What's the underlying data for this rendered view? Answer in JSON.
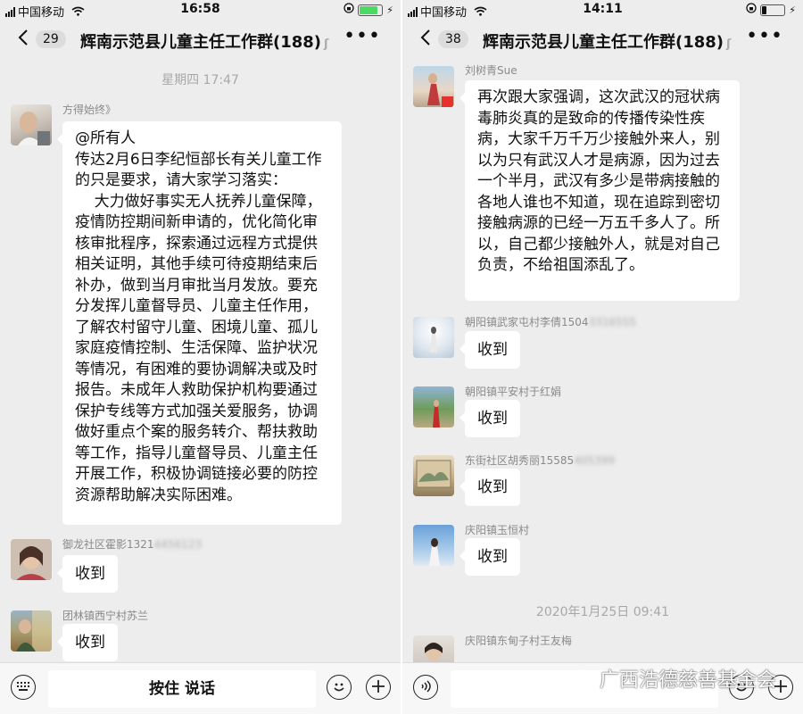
{
  "left": {
    "status": {
      "carrier": "中国移动",
      "time": "16:58"
    },
    "nav": {
      "back_count": "29",
      "title": "辉南示范县儿童主任工作群(188)"
    },
    "timestamp": "星期四 17:47",
    "messages": [
      {
        "sender": "方得始终》",
        "text": "@所有人\n传达2月6日李纪恒部长有关儿童工作的只是要求，请大家学习落实：\n    大力做好事实无人抚养儿童保障，疫情防控期间新申请的，优化简化审核审批程序，探索通过远程方式提供相关证明，其他手续可待疫期结束后补办，做到当月审批当月发放。要充分发挥儿童督导员、儿童主任作用，了解农村留守儿童、困境儿童、孤儿家庭疫情控制、生活保障、监护状况等情况，有困难的要协调解决或及时报告。未成年人救助保护机构要通过保护专线等方式加强关爱服务，协调做好重点个案的服务转介、帮扶救助等工作，指导儿童督导员、儿童主任开展工作，积极协调链接必要的防控资源帮助解决实际困难。"
      },
      {
        "sender": "御龙社区霍影1321",
        "sender_blur": "4456123",
        "text": "收到"
      },
      {
        "sender": "团林镇西宁村苏兰",
        "text": "收到"
      }
    ],
    "input": {
      "talk_label": "按住 说话"
    }
  },
  "right": {
    "status": {
      "carrier": "中国移动",
      "time": "14:11"
    },
    "nav": {
      "back_count": "38",
      "title": "辉南示范县儿童主任工作群(188)"
    },
    "messages": [
      {
        "sender": "刘树青Sue",
        "text": "再次跟大家强调，这次武汉的冠状病毒肺炎真的是致命的传播传染性疾病，大家千万千万少接触外来人，别以为只有武汉人才是病源，因为过去一个半月，武汉有多少是带病接触的各地人谁也不知道，现在追踪到密切接触病源的已经一万五千多人了。所以，自己都少接触外人，就是对自己负责，不给祖国添乱了。"
      },
      {
        "sender": "朝阳镇武家屯村李倩1504",
        "sender_blur": "3316555",
        "text": "收到"
      },
      {
        "sender": "朝阳镇平安村于红娟",
        "text": "收到"
      },
      {
        "sender": "东街社区胡秀丽15585",
        "sender_blur": "405399",
        "text": "收到"
      },
      {
        "sender": "庆阳镇玉恒村",
        "text": "收到"
      }
    ],
    "timestamp": "2020年1月25日 09:41",
    "last_sender": "庆阳镇东甸子村王友梅",
    "watermark": "广西浩德慈善基金会"
  },
  "icons": {
    "back": "chevron-left-icon",
    "more": "more-dots-icon",
    "keyboard": "keyboard-icon",
    "voice": "voice-icon",
    "emoji": "emoji-icon",
    "plus": "plus-icon"
  },
  "colors": {
    "background": "#ededed",
    "bubble": "#ffffff",
    "battery": "#4cd964"
  }
}
